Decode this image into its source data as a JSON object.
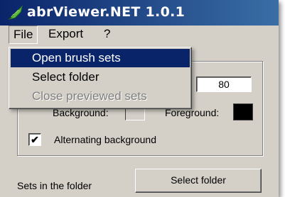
{
  "window": {
    "title": "abrViewer.NET 1.0.1",
    "icon": "feather-brush-icon"
  },
  "menubar": {
    "file": "File",
    "export": "Export",
    "help": "?"
  },
  "file_menu": {
    "items": [
      {
        "label": "Open brush sets",
        "state": "highlighted"
      },
      {
        "label": "Select folder",
        "state": "enabled"
      },
      {
        "label": "Close previewed sets",
        "state": "disabled"
      }
    ]
  },
  "options": {
    "size_value": "80",
    "background_label": "Background:",
    "foreground_label": "Foreground:",
    "background_color": "#d4d0c8",
    "foreground_color": "#000000",
    "alternating_label": "Alternating background",
    "alternating_checked": true,
    "check_glyph": "✔"
  },
  "folder": {
    "sets_label": "Sets in the folder",
    "select_button": "Select folder"
  },
  "colors": {
    "titlebar_start": "#0a246a",
    "titlebar_end": "#3a6ea5",
    "menu_highlight": "#0a246a"
  }
}
